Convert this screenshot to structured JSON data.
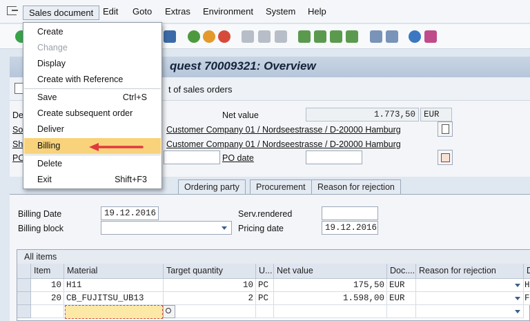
{
  "menubar": {
    "items": [
      "Sales document",
      "Edit",
      "Goto",
      "Extras",
      "Environment",
      "System",
      "Help"
    ]
  },
  "window": {
    "title_visible": "quest 70009321: Overview",
    "appbar_text": "t of sales orders"
  },
  "dropdown": {
    "items": [
      {
        "label": "Create",
        "shortcut": "",
        "disabled": false
      },
      {
        "label": "Change",
        "shortcut": "",
        "disabled": true
      },
      {
        "label": "Display",
        "shortcut": "",
        "disabled": false
      },
      {
        "label": "Create with Reference",
        "shortcut": "",
        "disabled": false
      },
      {
        "label": "Save",
        "shortcut": "Ctrl+S",
        "disabled": false
      },
      {
        "label": "Create subsequent order",
        "shortcut": "",
        "disabled": false
      },
      {
        "label": "Deliver",
        "shortcut": "",
        "disabled": false
      },
      {
        "label": "Billing",
        "shortcut": "",
        "disabled": false,
        "highlighted": true
      },
      {
        "label": "Delete",
        "shortcut": "",
        "disabled": false
      },
      {
        "label": "Exit",
        "shortcut": "Shift+F3",
        "disabled": false
      }
    ]
  },
  "header": {
    "net_value_label": "Net value",
    "net_value": "1.773,50",
    "currency": "EUR",
    "label_de": "De",
    "label_so": "So",
    "label_sh": "Sh",
    "label_po": "PO",
    "sold_to": "Customer Company 01 / Nordseestrasse / D-20000 Hamburg",
    "ship_to": "Customer Company 01 / Nordseestrasse / D-20000 Hamburg",
    "po_date_label": "PO date"
  },
  "tabs": [
    "Ordering party",
    "Procurement",
    "Reason for rejection"
  ],
  "billing": {
    "billing_date_label": "Billing Date",
    "billing_date": "19.12.2016",
    "billing_block_label": "Billing block",
    "serv_rendered_label": "Serv.rendered",
    "pricing_date_label": "Pricing date",
    "pricing_date": "19.12.2016"
  },
  "table": {
    "title": "All items",
    "columns": [
      "Item",
      "Material",
      "Target quantity",
      "U...",
      "Net value",
      "Doc....",
      "Reason for rejection",
      "D"
    ],
    "rows": [
      {
        "item": "10",
        "material": "H11",
        "qty": "10",
        "unit": "PC",
        "net": "175,50",
        "doc": "EUR",
        "extra": "H"
      },
      {
        "item": "20",
        "material": "CB_FUJITSU_UB13",
        "qty": "2",
        "unit": "PC",
        "net": "1.598,00",
        "doc": "EUR",
        "extra": "F"
      }
    ]
  },
  "colors": {
    "highlight": "#f8d37c",
    "arrow": "#e0393e"
  }
}
